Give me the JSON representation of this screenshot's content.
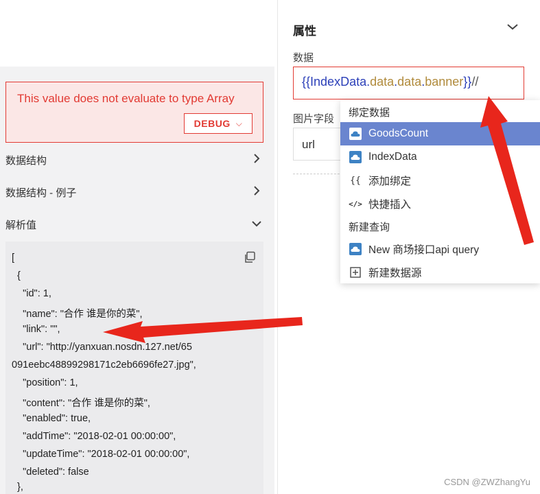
{
  "left": {
    "error_message": "This value does not evaluate to type Array",
    "debug_label": "DEBUG",
    "sections": [
      {
        "label": "数据结构",
        "arrow": "›"
      },
      {
        "label": "数据结构 - 例子",
        "arrow": "›"
      },
      {
        "label": "解析值",
        "arrow": "⌄"
      }
    ],
    "code_lines": [
      "[",
      "  {",
      "    \"id\": 1,",
      "    \"name\": \"合作 谁是你的菜\",",
      "    \"link\": \"\",",
      "    \"url\": \"http://yanxuan.nosdn.127.net/65",
      "091eebc48899298171c2eb6696fe27.jpg\",",
      "    \"position\": 1,",
      "    \"content\": \"合作 谁是你的菜\",",
      "    \"enabled\": true,",
      "    \"addTime\": \"2018-02-01 00:00:00\",",
      "    \"updateTime\": \"2018-02-01 00:00:00\",",
      "    \"deleted\": false",
      "  },"
    ]
  },
  "right": {
    "title": "属性",
    "data_label": "数据",
    "data_value": {
      "open_brace": "{{",
      "source": "IndexData",
      "dot": ".",
      "prop1": "data",
      "prop2": "data",
      "prop3": "banner",
      "close_brace": "}}",
      "tail": "//"
    },
    "image_field_label": "图片字段",
    "url_value": "url"
  },
  "dropdown": {
    "header_bind": "绑定数据",
    "items": [
      {
        "label": "GoodsCount",
        "icon": "cloud-icon",
        "selected": true
      },
      {
        "label": "IndexData",
        "icon": "cloud-icon",
        "selected": false
      },
      {
        "label": "添加绑定",
        "icon": "braces-icon",
        "selected": false
      },
      {
        "label": "快捷插入",
        "icon": "code-icon",
        "selected": false
      }
    ],
    "header_query": "新建查询",
    "items2": [
      {
        "label": "New 商场接口api query",
        "icon": "cloud-icon"
      },
      {
        "label": "新建数据源",
        "icon": "plus-box-icon"
      }
    ]
  },
  "watermark": "CSDN @ZWZhangYu",
  "colors": {
    "error_red": "#e23a33",
    "selected_blue": "#6a85cf",
    "cloud_blue": "#3d82c4",
    "binding_blue": "#2b3fb8",
    "prop_gold": "#b08a3b",
    "arrow_red": "#e8261c"
  }
}
